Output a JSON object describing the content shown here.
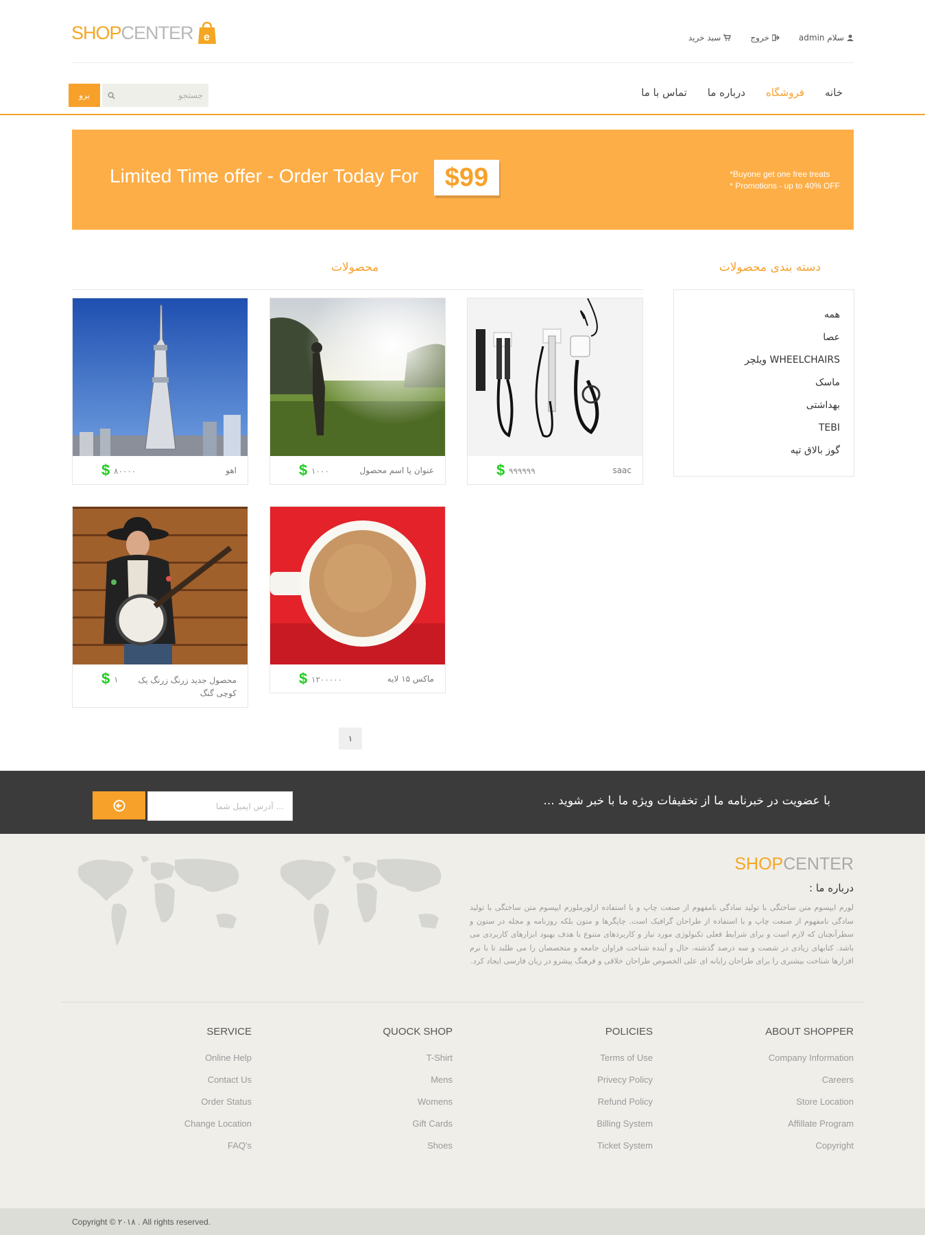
{
  "header": {
    "logo_shop": "SHOP",
    "logo_center": "CENTER",
    "top_links": [
      {
        "label": "سلام admin",
        "icon": "user-icon"
      },
      {
        "label": "خروج",
        "icon": "logout-icon"
      },
      {
        "label": "سبد خرید",
        "icon": "cart-icon"
      }
    ],
    "nav": [
      {
        "label": "خانه",
        "active": false
      },
      {
        "label": "فروشگاه",
        "active": true
      },
      {
        "label": "درباره ما",
        "active": false
      },
      {
        "label": "تماس با ما",
        "active": false
      }
    ],
    "search_placeholder": "جستجو",
    "go_label": "برو"
  },
  "banner": {
    "headline": "Limited Time offer - Order Today For",
    "price": "$99",
    "promo_1": "*Buyone get one free treats",
    "promo_2": "* Promotions - up to 40% OFF"
  },
  "categories": {
    "title": "دسته بندی محصولات",
    "items": [
      "همه",
      "عصا",
      "ویلچر WHEELCHAIRS",
      "ماسک",
      "بهداشتی",
      "TEBI",
      "گوز بالاق تپه"
    ]
  },
  "products": {
    "title": "محصولات",
    "items": [
      {
        "name": "saac",
        "price": "۹۹۹۹۹۹",
        "image": "medical-wall-instruments"
      },
      {
        "name": "عنوان یا اسم محصول",
        "price": "۱۰۰۰",
        "image": "person-in-sunny-field"
      },
      {
        "name": "اهو",
        "price": "۸۰۰۰۰",
        "image": "tokyo-sky-tree"
      },
      {
        "name": "ماکس ۱۵ لایه",
        "price": "۱۲۰۰۰۰۰",
        "image": "coffee-cup-red"
      },
      {
        "name": "محصول جدید زرنگ زرنگ یک کوچی گنگ",
        "price": "۱",
        "image": "banjo-player"
      }
    ],
    "currency_symbol": "$",
    "page": "۱"
  },
  "newsletter": {
    "message": "با عضویت در خبرنامه ما از تخفیفات ویژه ما با خبر شوید ...",
    "email_placeholder": "آدرس ایمیل شما ...",
    "submit_icon": "arrow-circle-icon"
  },
  "footer": {
    "logo_shop": "SHOP",
    "logo_center": "CENTER",
    "about_heading": "درباره ما :",
    "about_text": "لورم ایپسوم متن ساختگی با تولید سادگی نامفهوم از صنعت چاپ و با استفاده ازلورملورم ایپسوم متن ساختگی با تولید سادگی نامفهوم از صنعت چاپ و با استفاده از طراحان گرافیک است. چاپگرها و متون بلکه روزنامه و مجله در ستون و سطرآنچنان که لازم است و برای شرایط فعلی تکنولوژی مورد نیاز و کاربردهای متنوع با هدف بهبود ابزارهای کاربردی می باشد. کتابهای زیادی در شصت و سه درصد گذشته، حال و آینده شناخت فراوان جامعه و متخصصان را می طلبد تا با نرم افزارها شناخت بیشتری را برای طراحان رایانه ای علی الخصوص طراحان خلاقی و فرهنگ پیشرو در زبان فارسی ایجاد کرد.",
    "columns": [
      {
        "title": "ABOUT SHOPPER",
        "links": [
          "Company Information",
          "Careers",
          "Store Location",
          "Affillate Program",
          "Copyright"
        ]
      },
      {
        "title": "POLICIES",
        "links": [
          "Terms of Use",
          "Privecy Policy",
          "Refund Policy",
          "Billing System",
          "Ticket System"
        ]
      },
      {
        "title": "QUOCK SHOP",
        "links": [
          "T-Shirt",
          "Mens",
          "Womens",
          "Gift Cards",
          "Shoes"
        ]
      },
      {
        "title": "SERVICE",
        "links": [
          "Online Help",
          "Contact Us",
          "Order Status",
          "Change Location",
          "FAQ's"
        ]
      }
    ],
    "copyright": "Copyright © ۲۰۱۸ . All rights reserved."
  },
  "colors": {
    "accent": "#f7a12b",
    "banner": "#fdae47",
    "newsletter_bg": "#3b3b3b",
    "footer_bg": "#efeee9",
    "price_dollar": "#22cc22"
  }
}
